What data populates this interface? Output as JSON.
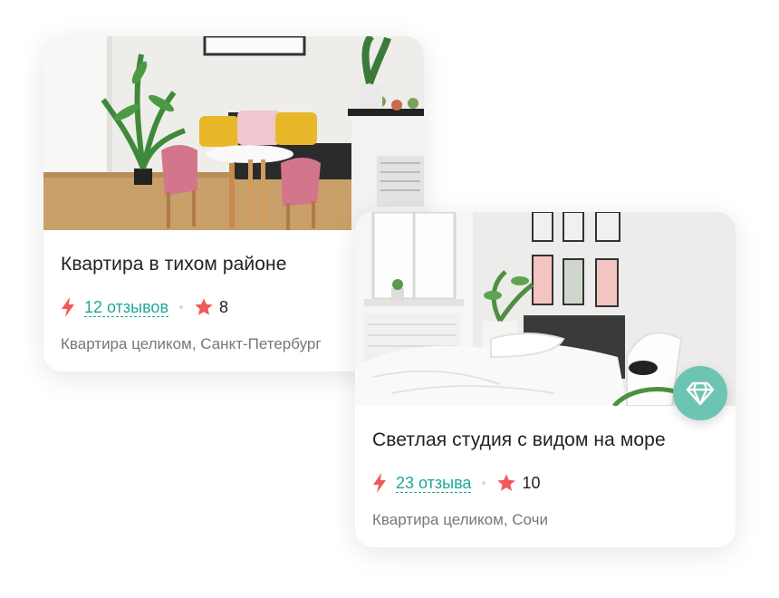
{
  "listings": [
    {
      "title": "Квартира в тихом районе",
      "reviews": "12 отзывов",
      "rating": "8",
      "subtitle": "Квартира целиком, Санкт-Петербург"
    },
    {
      "title": "Светлая студия с видом на море",
      "reviews": "23 отзыва",
      "rating": "10",
      "subtitle": "Квартира целиком, Сочи",
      "badge_icon": "diamond-icon"
    }
  ],
  "colors": {
    "accent": "#1ea898",
    "star": "#f05a5a",
    "badge": "#6ec4b3"
  }
}
